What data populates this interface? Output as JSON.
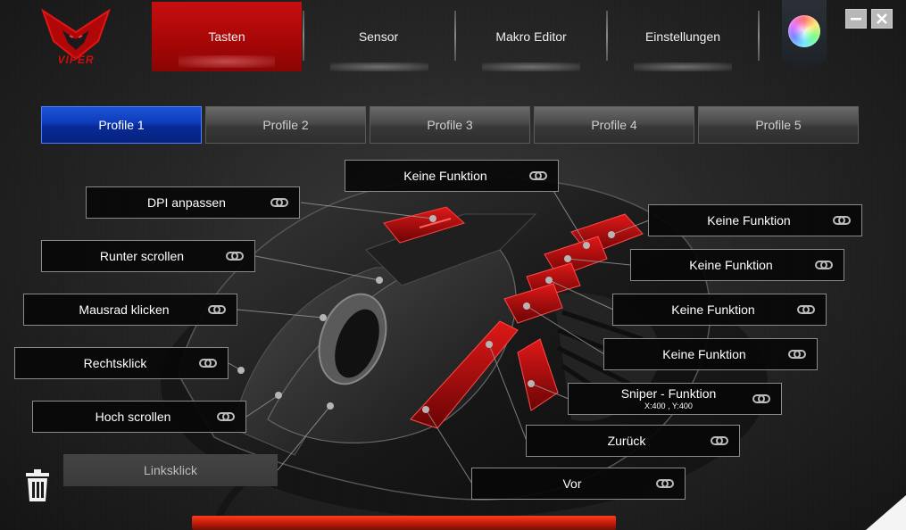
{
  "brand": {
    "logo_text": "VIPER"
  },
  "colors": {
    "accent_red": "#c70f0f",
    "profile_active": "#0d3bb8"
  },
  "nav": {
    "tabs": [
      {
        "label": "Tasten",
        "active": true
      },
      {
        "label": "Sensor",
        "active": false
      },
      {
        "label": "Makro Editor",
        "active": false
      },
      {
        "label": "Einstellungen",
        "active": false
      }
    ],
    "color_picker_icon": "color-wheel-icon"
  },
  "window": {
    "minimize_icon": "minimize-icon",
    "close_icon": "close-icon"
  },
  "profiles": [
    {
      "label": "Profile 1",
      "active": true
    },
    {
      "label": "Profile 2",
      "active": false
    },
    {
      "label": "Profile 3",
      "active": false
    },
    {
      "label": "Profile 4",
      "active": false
    },
    {
      "label": "Profile 5",
      "active": false
    }
  ],
  "buttons": {
    "top": "Keine Funktion",
    "dpi": "DPI anpassen",
    "scroll_down": "Runter scrollen",
    "wheel_click": "Mausrad klicken",
    "right_click": "Rechtsklick",
    "scroll_up": "Hoch scrollen",
    "left_click": "Linksklick",
    "side_1": "Keine Funktion",
    "side_2": "Keine Funktion",
    "side_3": "Keine Funktion",
    "side_4": "Keine Funktion",
    "sniper": "Sniper - Funktion",
    "sniper_sub": "X:400 , Y:400",
    "back": "Zurück",
    "forward": "Vor"
  },
  "icons": {
    "link": "link-icon",
    "trash": "trash-icon"
  }
}
